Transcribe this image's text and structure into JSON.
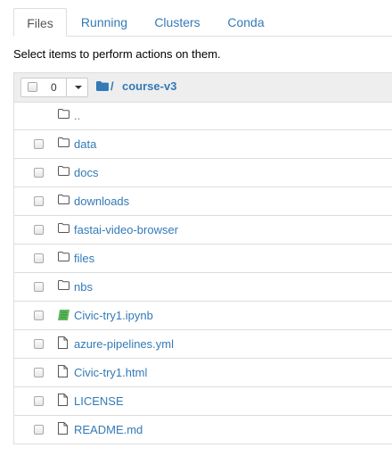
{
  "tabs": [
    {
      "label": "Files",
      "active": true
    },
    {
      "label": "Running",
      "active": false
    },
    {
      "label": "Clusters",
      "active": false
    },
    {
      "label": "Conda",
      "active": false
    }
  ],
  "hint": "Select items to perform actions on them.",
  "header": {
    "selected_count": "0",
    "breadcrumb_separator": "/",
    "breadcrumb_current": "course-v3"
  },
  "items": [
    {
      "name": "..",
      "type": "parent",
      "icon": "folder-outline-icon"
    },
    {
      "name": "data",
      "type": "folder",
      "icon": "folder-outline-icon"
    },
    {
      "name": "docs",
      "type": "folder",
      "icon": "folder-outline-icon"
    },
    {
      "name": "downloads",
      "type": "folder",
      "icon": "folder-outline-icon"
    },
    {
      "name": "fastai-video-browser",
      "type": "folder",
      "icon": "folder-outline-icon"
    },
    {
      "name": "files",
      "type": "folder",
      "icon": "folder-outline-icon"
    },
    {
      "name": "nbs",
      "type": "folder",
      "icon": "folder-outline-icon"
    },
    {
      "name": "Civic-try1.ipynb",
      "type": "notebook",
      "icon": "notebook-icon"
    },
    {
      "name": "azure-pipelines.yml",
      "type": "file",
      "icon": "file-icon"
    },
    {
      "name": "Civic-try1.html",
      "type": "file",
      "icon": "file-icon"
    },
    {
      "name": "LICENSE",
      "type": "file",
      "icon": "file-icon"
    },
    {
      "name": "README.md",
      "type": "file",
      "icon": "file-icon"
    }
  ],
  "colors": {
    "link": "#337ab7",
    "notebook_green": "#5cb85c",
    "header_bg": "#eeeeee",
    "border": "#dddddd"
  }
}
